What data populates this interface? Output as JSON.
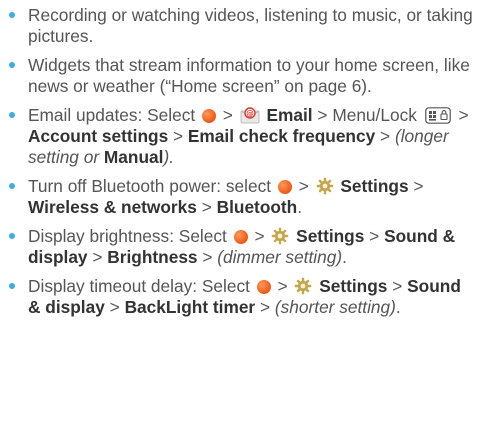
{
  "colors": {
    "bullet": "#3aaee0",
    "text": "#555555",
    "bold_text": "#333333",
    "launcher_orange": "#f26522"
  },
  "bullets": [
    {
      "text": "Recording or watching videos, listening to music, or taking pictures."
    },
    {
      "text": "Widgets that stream information to your home screen, like news or weather (“Home screen” on page 6)."
    },
    {
      "prefix": "Email updates: Select",
      "sep1": ">",
      "app": "Email",
      "sep2": "> Menu/Lock",
      "sep3": ">",
      "path1": "Account settings",
      "sep4": ">",
      "path2": "Email check frequency",
      "sep5": ">",
      "note_open": "(longer setting or",
      "note_bold": "Manual",
      "note_close": ")."
    },
    {
      "prefix": "Turn off Bluetooth power: select",
      "sep1": ">",
      "app": "Settings",
      "sep2": ">",
      "path1": "Wireless & networks",
      "sep3": ">",
      "path2": "Bluetooth",
      "end": "."
    },
    {
      "prefix": "Display brightness: Select",
      "sep1": ">",
      "app": "Settings",
      "sep2": ">",
      "path1": "Sound & display",
      "sep3": ">",
      "path2": "Brightness",
      "sep4": ">",
      "note": "(dimmer setting)",
      "end": "."
    },
    {
      "prefix": "Display timeout delay: Select",
      "sep1": ">",
      "app": "Settings",
      "sep2": ">",
      "path1": "Sound & display",
      "sep3": ">",
      "path2": "BackLight timer",
      "sep4": ">",
      "note": "(shorter setting)",
      "end": "."
    }
  ],
  "icons": {
    "launcher": "launcher-icon",
    "email": "email-icon",
    "settings": "gear-icon",
    "menu_lock": "menu-key-icon"
  }
}
